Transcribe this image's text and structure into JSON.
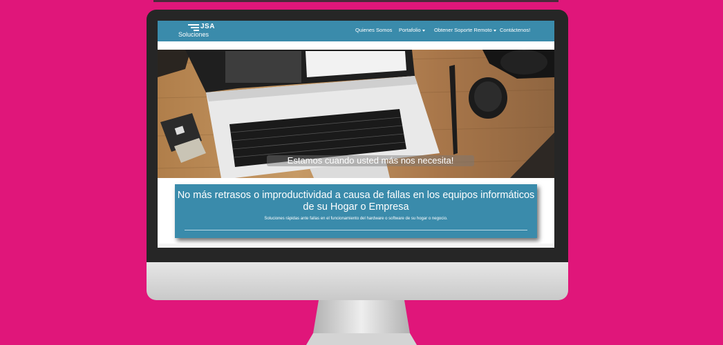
{
  "colors": {
    "background": "#e0167a",
    "navbar": "#3a8bab",
    "banner": "#3a8bab"
  },
  "logo": {
    "line1": "JSA",
    "line2": "Soluciones"
  },
  "nav": {
    "items": [
      {
        "label": "Quienes Somos",
        "dropdown": false
      },
      {
        "label": "Portafolio",
        "dropdown": true
      },
      {
        "label": "Obtener Soporte Remoto",
        "dropdown": true
      },
      {
        "label": "Contáctenos!",
        "dropdown": false
      }
    ]
  },
  "hero": {
    "caption": "Estamos cuando usted más nos necesita!"
  },
  "banner": {
    "title_line1": "No más retrasos o improductividad a causa de fallas en los equipos informáticos",
    "title_line2": "de su Hogar o Empresa",
    "subtitle": "Soluciones rápidas ante fallas en el funcionamiento del hardware o software de su hogar o negocio."
  }
}
